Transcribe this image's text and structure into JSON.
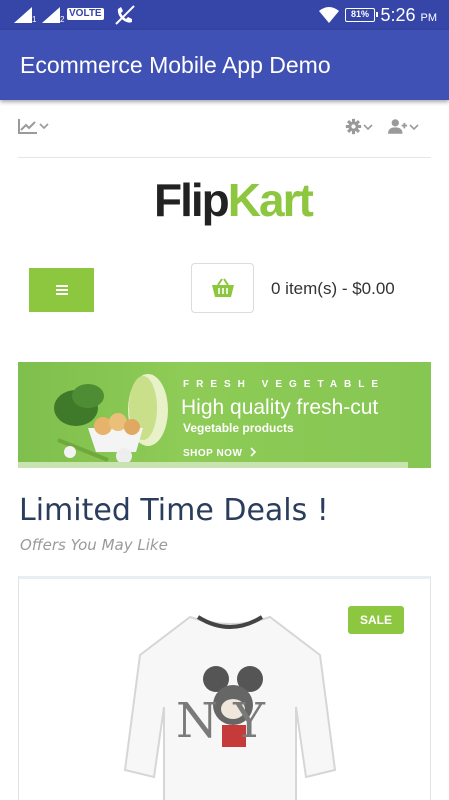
{
  "status_bar": {
    "sim1": "1",
    "sim2": "2",
    "volte": "VOLTE",
    "battery": "81%",
    "time": "5:26",
    "ampm": "PM"
  },
  "app_bar": {
    "title": "Ecommerce Mobile App Demo"
  },
  "toolbar": {
    "left_icon": "line-chart-icon",
    "right_icons": [
      "gear-icon",
      "user-plus-icon"
    ]
  },
  "logo": {
    "text_dark": "Flip",
    "text_green": "Kart"
  },
  "cart": {
    "summary": "0 item(s) - $0.00"
  },
  "banner": {
    "kicker": "FRESH VEGETABLE",
    "headline": "High quality fresh-cut",
    "sub": "Vegetable products",
    "cta": "SHOP NOW"
  },
  "deals": {
    "title": "Limited Time Deals !",
    "subtitle": "Offers You May Like"
  },
  "product": {
    "badge": "SALE",
    "sweater_print": "N Y"
  },
  "colors": {
    "status_bar": "#3545a8",
    "app_bar": "#3f51b5",
    "accent_green": "#8dc63f",
    "heading": "#2b3d5c"
  }
}
